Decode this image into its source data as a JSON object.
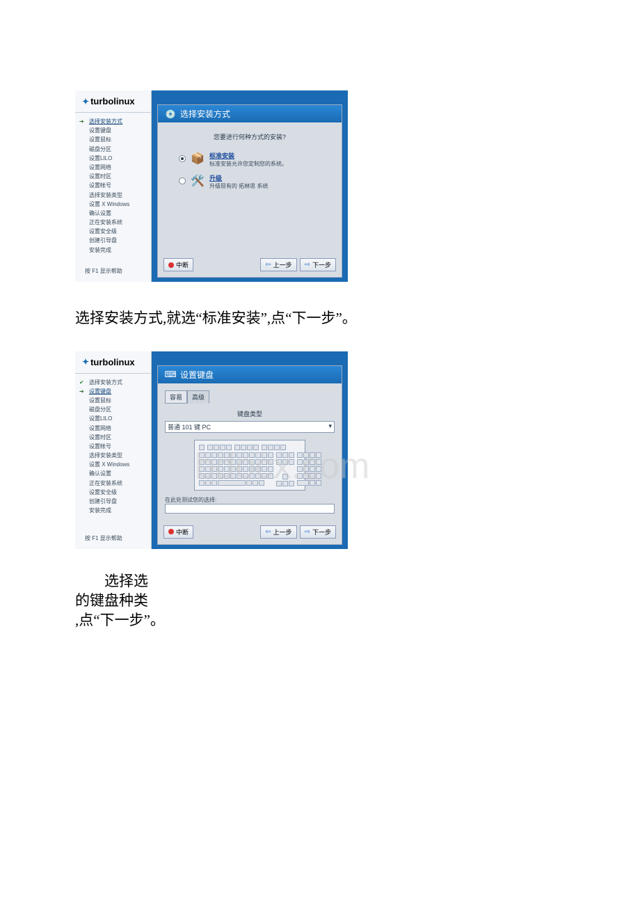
{
  "watermark": "bdocx.com",
  "brand": "turbolinux",
  "sidebar_steps": [
    "选择安装方式",
    "设置键盘",
    "设置鼠标",
    "磁盘分区",
    "设置LILO",
    "设置网络",
    "设置时区",
    "设置帐号",
    "选择安装类型",
    "设置 X Windows",
    "确认设置",
    "正在安装系统",
    "设置安全级",
    "创建引导盘",
    "安装完成"
  ],
  "help_text": "按 F1 显示帮助",
  "screen1": {
    "title": "选择安装方式",
    "prompt": "您要进行何种方式的安装?",
    "opt1_title": "标准安装",
    "opt1_desc": "标准安装允许您定制您的系统。",
    "opt2_title": "升级",
    "opt2_desc": "升级现有的 拓林思 系统"
  },
  "screen2": {
    "title": "设置键盘",
    "tab_easy": "容易",
    "tab_adv": "高级",
    "kbd_type_label": "键盘类型",
    "kbd_selected": "普通 101 键 PC",
    "test_label": "在此处测试您的选择:"
  },
  "buttons": {
    "cancel": "中断",
    "prev": "上一步",
    "next": "下一步"
  },
  "doc": {
    "para1": "选择安装方式,就选“标准安装”,点“下一步”。",
    "para2_l1": "选择选",
    "para2_l2": "的键盘种类",
    "para2_l3": ",点“下一步”。"
  }
}
